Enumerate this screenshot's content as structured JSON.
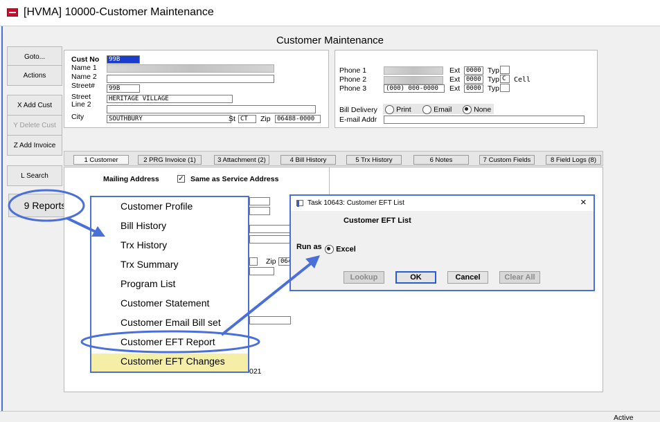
{
  "window": {
    "title": "[HVMA] 10000-Customer Maintenance"
  },
  "page_title": "Customer Maintenance",
  "sidebar": {
    "goto": "Goto...",
    "actions": "Actions",
    "add_cust": "X Add Cust",
    "delete_cust": "Y Delete Cust",
    "add_invoice": "Z Add Invoice",
    "search": "L Search",
    "reports": "9 Reports"
  },
  "customer": {
    "labels": {
      "cust_no": "Cust No",
      "name1": "Name 1",
      "name2": "Name 2",
      "street_no": "Street#",
      "street": "Street",
      "line2": "Line 2",
      "city": "City",
      "st": "St",
      "zip": "Zip"
    },
    "cust_no": "99B",
    "street_no": "99B",
    "street": "HERITAGE VILLAGE",
    "city": "SOUTHBURY",
    "state": "CT",
    "zip": "06488-0000"
  },
  "contact": {
    "labels": {
      "phone1": "Phone 1",
      "phone2": "Phone 2",
      "phone3": "Phone 3",
      "ext": "Ext",
      "typ": "Typ",
      "bill_delivery": "Bill Delivery",
      "email_addr": "E-mail Addr"
    },
    "phone1_ext": "0000",
    "phone2_ext": "0000",
    "phone2_typ": "C",
    "phone2_typ_desc": "Cell",
    "phone3": "(000) 000-0000",
    "phone3_ext": "0000",
    "delivery_options": [
      "Print",
      "Email",
      "None"
    ],
    "delivery_selected": "None"
  },
  "tabs": [
    "1 Customer",
    "2 PRG Invoice (1)",
    "3 Attachment (2)",
    "4 Bill History",
    "5 Trx History",
    "6 Notes",
    "7 Custom Fields",
    "8 Field Logs (8)"
  ],
  "mailing": {
    "header": "Mailing Address",
    "same_label": "Same as Service Address",
    "zip_label": "Zip",
    "zip_partial": "0648",
    "date_partial": "021"
  },
  "reports_menu": {
    "items": [
      "Customer Profile",
      "Bill History",
      "Trx History",
      "Trx Summary",
      "Program List",
      "Customer Statement",
      "Customer Email Bill set",
      "Customer EFT Report",
      "Customer EFT Changes"
    ]
  },
  "dialog": {
    "title": "Task 10643: Customer EFT List",
    "close": "×",
    "heading": "Customer EFT List",
    "run_as_label": "Run as",
    "run_as_option": "Excel",
    "buttons": {
      "lookup": "Lookup",
      "ok": "OK",
      "cancel": "Cancel",
      "clear_all": "Clear All"
    }
  },
  "status_bar": {
    "state": "Active"
  },
  "colors": {
    "accent": "#4a6fd8",
    "selection": "#1a3ccf",
    "menu_highlight": "#f5eea6"
  }
}
